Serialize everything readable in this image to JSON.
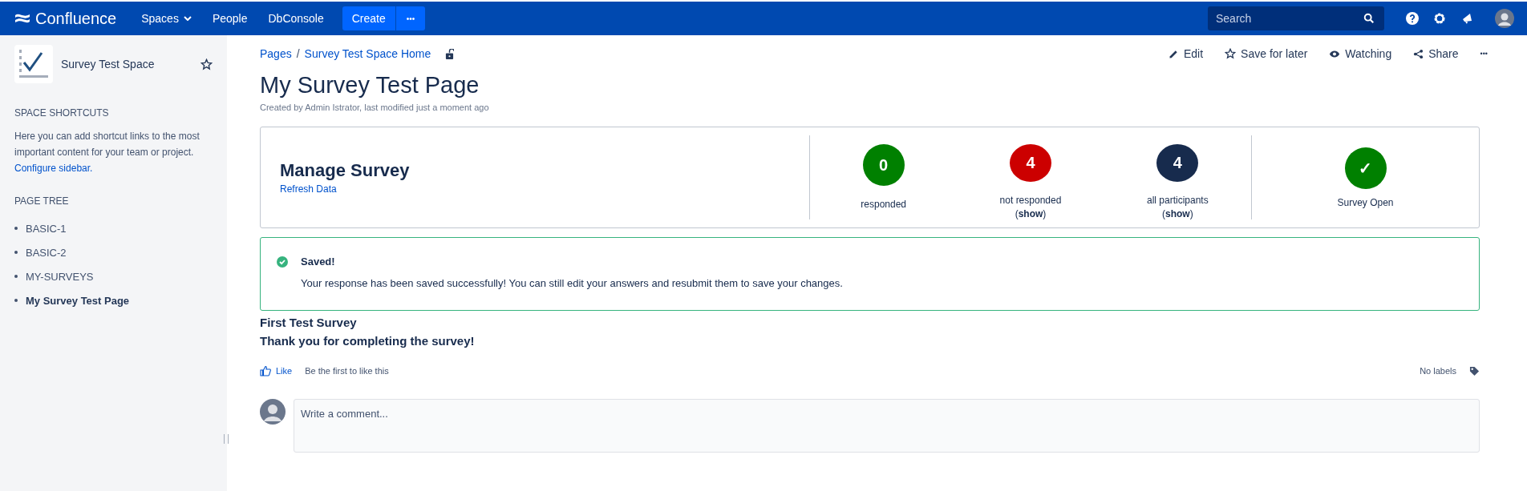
{
  "topbar": {
    "logo": "Confluence",
    "nav": [
      {
        "label": "Spaces",
        "dropdown": true
      },
      {
        "label": "People",
        "dropdown": false
      },
      {
        "label": "DbConsole",
        "dropdown": false
      }
    ],
    "create": "Create",
    "more": "•••",
    "search": {
      "placeholder": "Search"
    }
  },
  "sidebar": {
    "space_name": "Survey Test Space",
    "shortcuts_heading": "SPACE SHORTCUTS",
    "shortcuts_text": "Here you can add shortcut links to the most important content for your team or project.",
    "configure_link": "Configure sidebar.",
    "tree_heading": "PAGE TREE",
    "tree": [
      {
        "label": "BASIC-1",
        "selected": false
      },
      {
        "label": "BASIC-2",
        "selected": false
      },
      {
        "label": "MY-SURVEYS",
        "selected": false
      },
      {
        "label": "My Survey Test Page",
        "selected": true
      }
    ]
  },
  "breadcrumbs": [
    "Pages",
    "Survey Test Space Home"
  ],
  "breadcrumb_separator": "/",
  "actions": [
    {
      "kind": "edit",
      "label": "Edit"
    },
    {
      "kind": "save",
      "label": "Save for later"
    },
    {
      "kind": "watch",
      "label": "Watching"
    },
    {
      "kind": "share",
      "label": "Share"
    },
    {
      "kind": "more",
      "label": "•••"
    }
  ],
  "page": {
    "title": "My Survey Test Page",
    "byline": "Created by Admin Istrator, last modified just a moment ago"
  },
  "survey": {
    "title": "Manage Survey",
    "refresh": "Refresh Data",
    "stats": [
      {
        "value": "0",
        "label": "responded",
        "color": "#008000"
      },
      {
        "value": "4",
        "label": "not responded",
        "link": "(**show**)",
        "color": "#cc0000"
      },
      {
        "value": "4",
        "label": "all participants",
        "link": "(**show**)",
        "color": "#172b4d"
      }
    ],
    "status": {
      "value": "✓",
      "label": "Survey Open",
      "color": "#008000"
    }
  },
  "message": {
    "title": "Saved!",
    "text": "Your response has been saved successfully! You can still edit your answers and resubmit them to save your changes."
  },
  "content": [
    "First Test Survey",
    "Thank you for completing the survey!"
  ],
  "like": {
    "label": "Like",
    "text": "Be the first to like this"
  },
  "labels": "No labels",
  "comment": {
    "placeholder": "Write a comment..."
  }
}
